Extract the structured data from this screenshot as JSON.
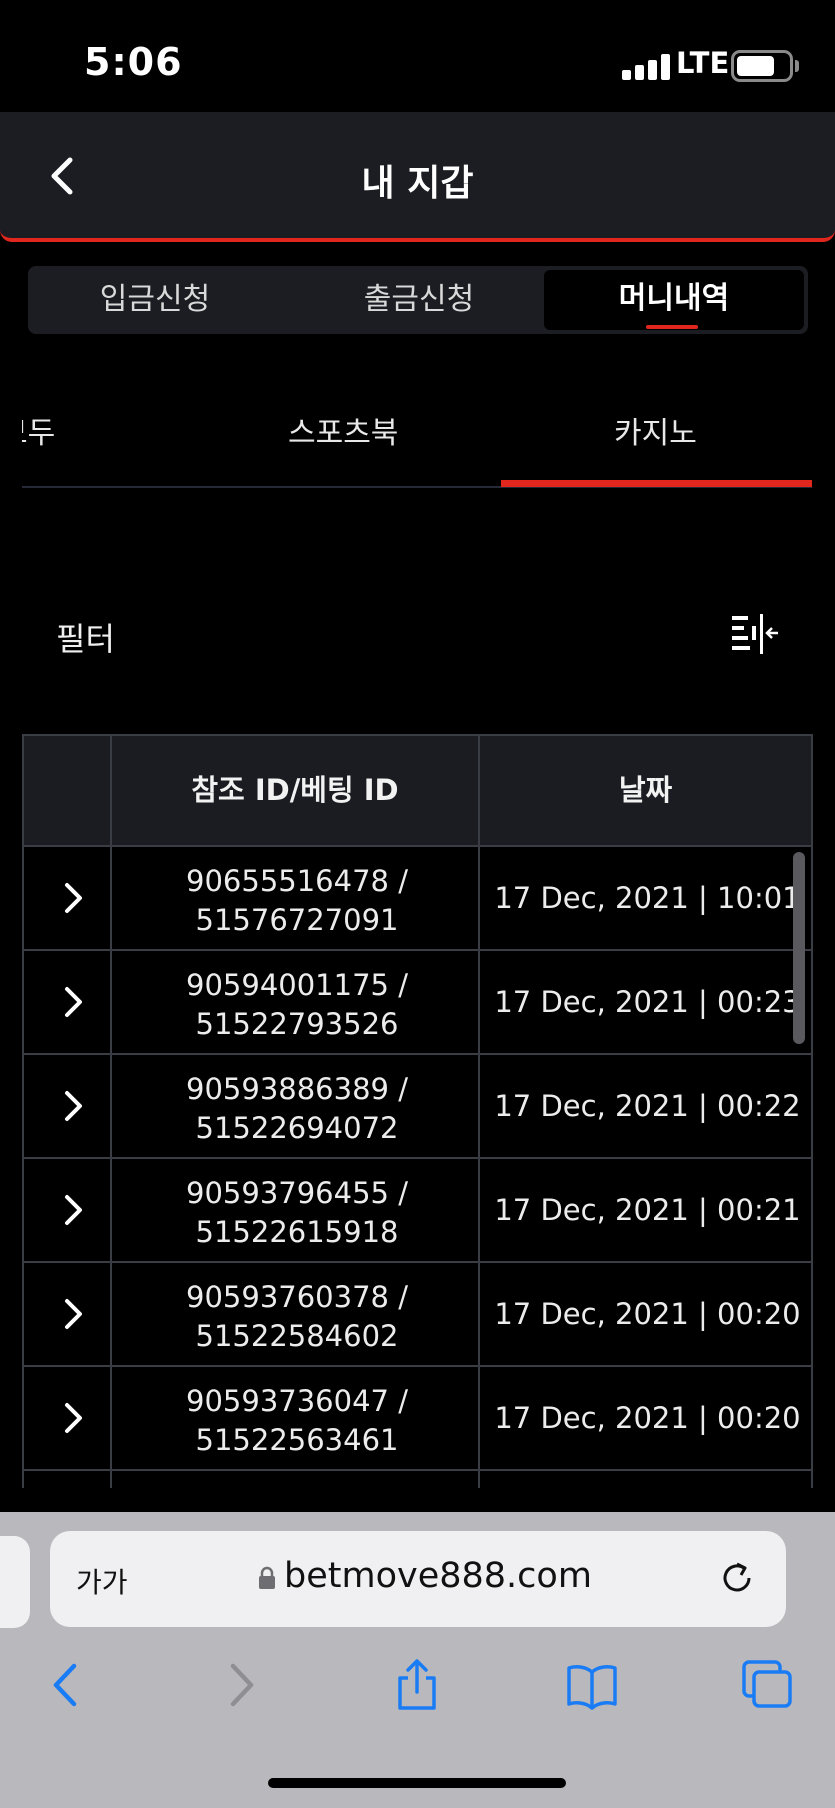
{
  "status_bar": {
    "time": "5:06",
    "network": "LTE"
  },
  "header": {
    "title": "내 지갑"
  },
  "segment_tabs": [
    {
      "label": "입금신청",
      "active": false
    },
    {
      "label": "출금신청",
      "active": false
    },
    {
      "label": "머니내역",
      "active": true
    }
  ],
  "sub_tabs": [
    {
      "label": "모두",
      "active": false
    },
    {
      "label": "스포츠북",
      "active": false
    },
    {
      "label": "카지노",
      "active": true
    }
  ],
  "filter": {
    "label": "필터"
  },
  "table": {
    "columns": [
      "",
      "참조 ID/베팅 ID",
      "날짜"
    ],
    "rows": [
      {
        "ref_id": "90655516478 /",
        "bet_id": "51576727091",
        "date": "17 Dec, 2021 | 10:01"
      },
      {
        "ref_id": "90594001175 /",
        "bet_id": "51522793526",
        "date": "17 Dec, 2021 | 00:23"
      },
      {
        "ref_id": "90593886389 /",
        "bet_id": "51522694072",
        "date": "17 Dec, 2021 | 00:22"
      },
      {
        "ref_id": "90593796455 /",
        "bet_id": "51522615918",
        "date": "17 Dec, 2021 | 00:21"
      },
      {
        "ref_id": "90593760378 /",
        "bet_id": "51522584602",
        "date": "17 Dec, 2021 | 00:20"
      },
      {
        "ref_id": "90593736047 /",
        "bet_id": "51522563461",
        "date": "17 Dec, 2021 | 00:20"
      }
    ]
  },
  "browser": {
    "text_size_label": "가가",
    "url": "betmove888.com",
    "toolbar_icons": [
      "back-icon",
      "forward-icon",
      "share-icon",
      "bookmarks-icon",
      "tabs-icon"
    ]
  },
  "colors": {
    "accent": "#e0261d",
    "surface": "#1c1d22",
    "border": "#3b3d44",
    "link_blue": "#1a7cf5"
  }
}
